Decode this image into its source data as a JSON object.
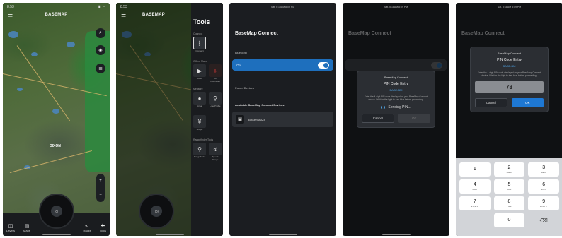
{
  "screen1": {
    "status_time": "8:53",
    "map_title": "BASEMAP",
    "map_label": "DIXON",
    "bottom_items": [
      {
        "icon": "layers-icon",
        "label": "Layers"
      },
      {
        "icon": "map-icon",
        "label": "Maps"
      },
      {
        "icon": "tracks-icon",
        "label": "Tracks"
      },
      {
        "icon": "tools-icon",
        "label": "Tools"
      }
    ]
  },
  "screen2": {
    "status_time": "8:53",
    "map_title": "BASEMAP",
    "tools_title": "Tools",
    "sections": [
      {
        "label": "Connect",
        "tools": [
          {
            "label": "Connect",
            "selected": true
          }
        ]
      },
      {
        "label": "Offline Maps",
        "tools": [
          {
            "label": "Video"
          },
          {
            "label": "Off Download"
          }
        ]
      },
      {
        "label": "Measure",
        "tools": [
          {
            "label": "Area"
          },
          {
            "label": "Line Profile"
          },
          {
            "label": "Shape"
          }
        ]
      },
      {
        "label": "Rangefinder Tools",
        "tools": [
          {
            "label": "Rangefinder"
          },
          {
            "label": "Speed Range"
          }
        ]
      }
    ]
  },
  "screen3": {
    "status_center": "Sat, 5:18AM 8:09 PM",
    "title": "BaseMap Connect",
    "bluetooth_label": "Bluetooth",
    "bluetooth_state": "On",
    "paired_label": "Paired Devices",
    "available_label": "Available BaseMap Connect Devices",
    "device_name": "BaseMap28"
  },
  "screen4": {
    "status_center": "Sat, 5:18AM 8:09 PM",
    "dialog_head": "BaseMap Connect",
    "dialog_title": "PIN Code Entry",
    "dialog_code": "BASE-BM",
    "dialog_body": "Enter the 4-digit PIN code displayed on your BaseMap Connect device. Wait for the light to turn blue before proceeding.",
    "sending_text": "Sending PIN...",
    "cancel_label": "Cancel",
    "ok_label": "OK"
  },
  "screen5": {
    "status_center": "Sat, 5:18AM 8:09 PM",
    "dialog_head": "BaseMap Connect",
    "dialog_title": "PIN Code Entry",
    "dialog_code": "BASE-BM",
    "dialog_body": "Enter the 4-digit PIN code displayed on your BaseMap Connect device. Wait for the light to turn blue before proceeding.",
    "pin_value": "78",
    "cancel_label": "Cancel",
    "ok_label": "OK",
    "keys": [
      {
        "num": "1",
        "let": ""
      },
      {
        "num": "2",
        "let": "ABC"
      },
      {
        "num": "3",
        "let": "DEF"
      },
      {
        "num": "4",
        "let": "GHI"
      },
      {
        "num": "5",
        "let": "JKL"
      },
      {
        "num": "6",
        "let": "MNO"
      },
      {
        "num": "7",
        "let": "PQRS"
      },
      {
        "num": "8",
        "let": "TUV"
      },
      {
        "num": "9",
        "let": "WXYZ"
      },
      {
        "num": "",
        "let": ""
      },
      {
        "num": "0",
        "let": ""
      },
      {
        "num": "⌫",
        "let": ""
      }
    ]
  }
}
